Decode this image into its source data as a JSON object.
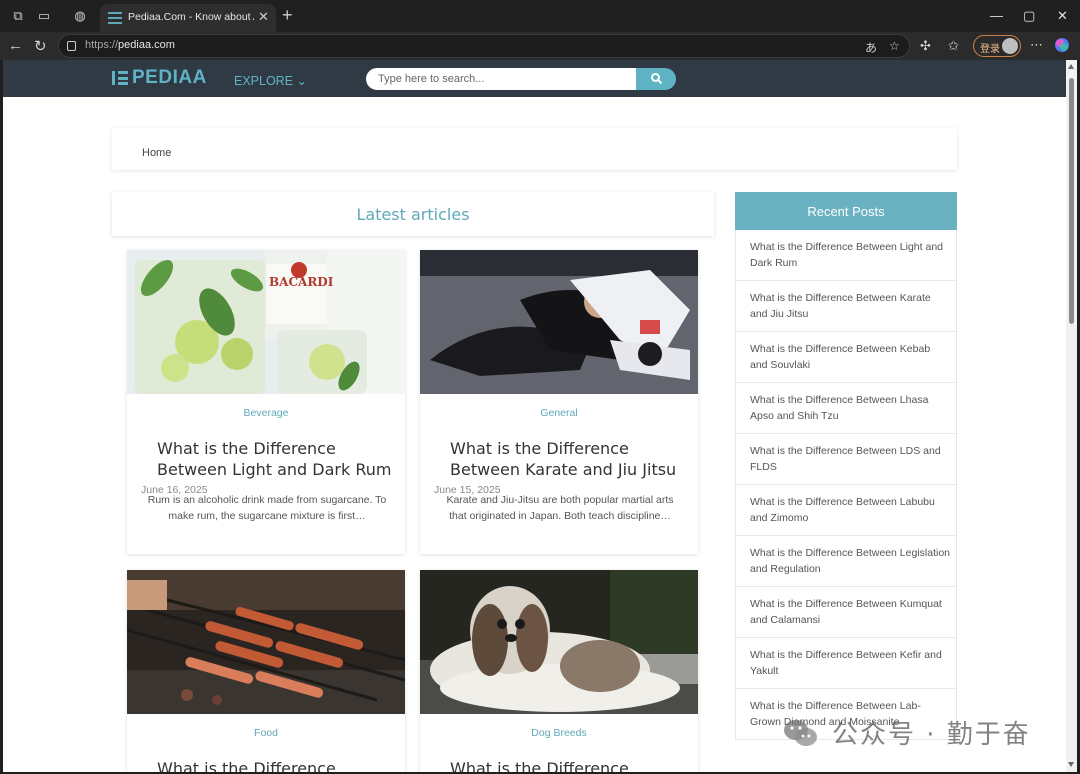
{
  "browser": {
    "tab_title": "Pediaa.Com - Know about Anything",
    "url_protocol": "https://",
    "url_host": "pediaa.com",
    "profile_label": "登录"
  },
  "site": {
    "logo_text": "PEDIAA",
    "explore_label": "EXPLORE ⌄",
    "search_placeholder": "Type here to search...",
    "breadcrumb": "Home",
    "latest_heading": "Latest articles"
  },
  "articles": [
    {
      "category": "Beverage",
      "title": "What is the Difference Between Light and Dark Rum",
      "date": "June 16, 2025",
      "excerpt": "Rum is an alcoholic drink made from sugarcane. To make rum, the sugarcane mixture is first…"
    },
    {
      "category": "General",
      "title": "What is the Difference Between Karate and Jiu Jitsu",
      "date": "June 15, 2025",
      "excerpt": "Karate and Jiu-Jitsu are both popular martial arts that originated in Japan. Both teach discipline…"
    },
    {
      "category": "Food",
      "title": "What is the Difference"
    },
    {
      "category": "Dog Breeds",
      "title": "What is the Difference"
    }
  ],
  "sidebar": {
    "heading": "Recent Posts",
    "items": [
      "What is the Difference Between Light and Dark Rum",
      "What is the Difference Between Karate and Jiu Jitsu",
      "What is the Difference Between Kebab and Souvlaki",
      "What is the Difference Between Lhasa Apso and Shih Tzu",
      "What is the Difference Between LDS and FLDS",
      "What is the Difference Between Labubu and Zimomo",
      "What is the Difference Between Legislation and Regulation",
      "What is the Difference Between Kumquat and Calamansi",
      "What is the Difference Between Kefir and Yakult",
      "What is the Difference Between Lab-Grown Diamond and Moissanite"
    ]
  },
  "watermark": "公众号 · 勤于奋",
  "colors": {
    "accent": "#5fb3c4",
    "header_bg": "#2f3a45",
    "sidebar_head": "#6ab1c1"
  }
}
